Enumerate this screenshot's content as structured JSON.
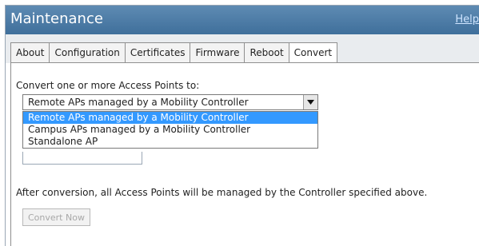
{
  "window": {
    "title": "Maintenance",
    "help": "Help"
  },
  "tabs": [
    {
      "label": "About"
    },
    {
      "label": "Configuration"
    },
    {
      "label": "Certificates"
    },
    {
      "label": "Firmware"
    },
    {
      "label": "Reboot"
    },
    {
      "label": "Convert",
      "active": true
    }
  ],
  "convert": {
    "prompt": "Convert one or more Access Points to:",
    "selected": "Remote APs managed by a Mobility Controller",
    "options": [
      "Remote APs managed by a Mobility Controller",
      "Campus APs managed by a Mobility Controller",
      "Standalone AP"
    ],
    "note": "After conversion, all Access Points will be managed by the Controller specified above.",
    "button": "Convert Now"
  }
}
